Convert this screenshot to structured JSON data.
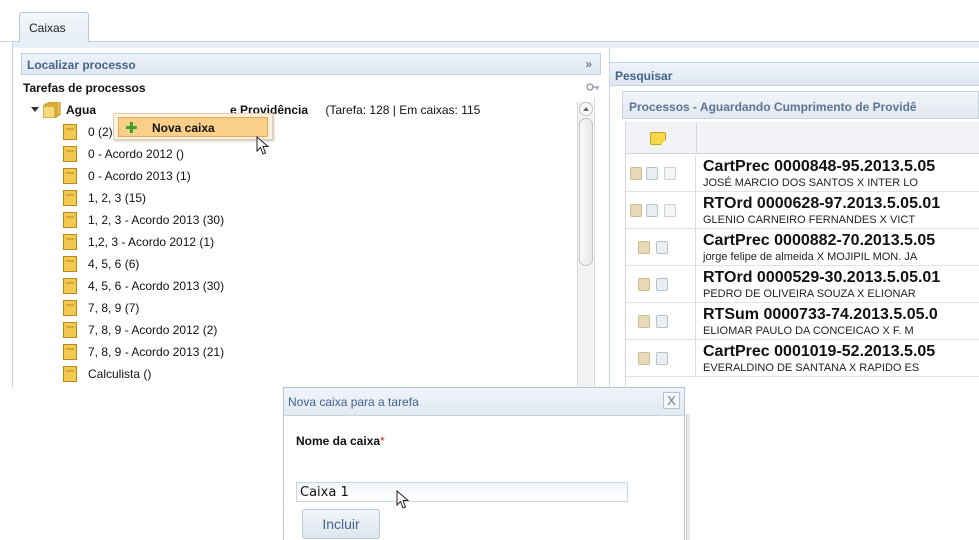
{
  "tab": {
    "label": "Caixas"
  },
  "left": {
    "localizar_label": "Localizar processo",
    "localizar_chevron": "»",
    "tarefas_label": "Tarefas de processos",
    "root": {
      "name_prefix": "Agua",
      "name_suffix": "e Providência",
      "counts": "(Tarefa: 128 | Em caixas: 115"
    },
    "items": [
      {
        "label": "0 (2)"
      },
      {
        "label": "0 - Acordo 2012   ()"
      },
      {
        "label": "0 - Acordo 2013   (1)"
      },
      {
        "label": "1, 2, 3   (15)"
      },
      {
        "label": "1, 2, 3 - Acordo 2013   (30)"
      },
      {
        "label": "1,2, 3 - Acordo 2012   (1)"
      },
      {
        "label": "4, 5, 6   (6)"
      },
      {
        "label": "4, 5, 6 - Acordo 2013   (30)"
      },
      {
        "label": "7, 8, 9   (7)"
      },
      {
        "label": "7, 8, 9 - Acordo 2012   (2)"
      },
      {
        "label": "7, 8, 9 - Acordo 2013   (21)"
      },
      {
        "label": "Calculista   ()"
      }
    ]
  },
  "context_menu": {
    "item_label": "Nova caixa"
  },
  "right": {
    "pesquisar_label": "Pesquisar",
    "processos_header": "Processos - Aguardando Cumprimento de Providê",
    "rows": [
      {
        "number": "CartPrec 0000848-95.2013.5.05",
        "parties": "JOSÉ MARCIO DOS SANTOS X INTER LO"
      },
      {
        "number": "RTOrd 0000628-97.2013.5.05.01",
        "parties": "GLENIO CARNEIRO FERNANDES X VICT"
      },
      {
        "number": "CartPrec 0000882-70.2013.5.05",
        "parties": "jorge felipe de almeida X MOJIPIL MON. JA"
      },
      {
        "number": "RTOrd 0000529-30.2013.5.05.01",
        "parties": "PEDRO DE OLIVEIRA SOUZA X ELIONAR"
      },
      {
        "number": "RTSum 0000733-74.2013.5.05.0",
        "parties": "ELIOMAR PAULO DA CONCEICAO X F. M"
      },
      {
        "number": "CartPrec 0001019-52.2013.5.05",
        "parties": "EVERALDINO DE SANTANA X RAPIDO ES"
      }
    ]
  },
  "dialog": {
    "title": "Nova caixa para a tarefa",
    "close_glyph": "X",
    "field_label": "Nome da caixa",
    "required_mark": "*",
    "field_value": "Caixa 1",
    "submit_label": "Incluir"
  },
  "colors": {
    "header_text": "#44648a",
    "context_item_bg": "#f9cf8a",
    "folder_yellow": "#f3c84e"
  },
  "icons": [
    "expand-arrow-icon",
    "folders-icon",
    "folder-icon",
    "key-icon",
    "add-plus-icon",
    "note-icon",
    "document-icon",
    "mouse-cursor-icon"
  ]
}
